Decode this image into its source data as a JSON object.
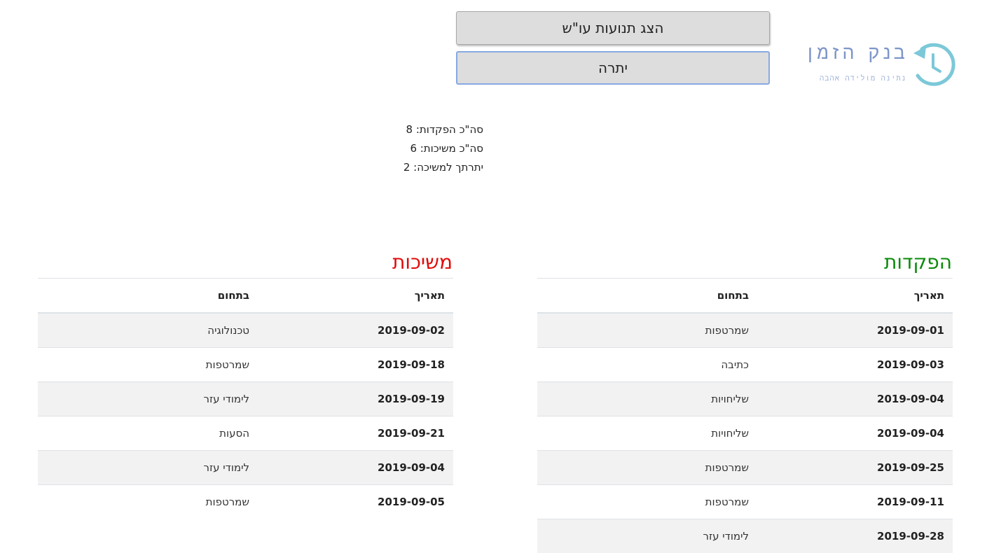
{
  "logo": {
    "title": "בנק הזמן",
    "subtitle": "נתינה מולידה אהבה",
    "colors": {
      "text": "#7d95c7",
      "clock": "#7cc8d8"
    }
  },
  "buttons": {
    "show_transactions": "הצג תנועות עו\"ש",
    "balance": "יתרה"
  },
  "totals": {
    "deposits_line": "סה\"כ הפקדות: 8",
    "withdrawals_line": "סה\"כ משיכות: 6",
    "balance_line": "יתרתך למשיכה: 2"
  },
  "deposits": {
    "title": "הפקדות",
    "columns": {
      "date": "תאריך",
      "field": "בתחום"
    },
    "rows": [
      {
        "date": "2019-09-01",
        "field": "שמרטפות"
      },
      {
        "date": "2019-09-03",
        "field": "כתיבה"
      },
      {
        "date": "2019-09-04",
        "field": "שליחויות"
      },
      {
        "date": "2019-09-04",
        "field": "שליחויות"
      },
      {
        "date": "2019-09-25",
        "field": "שמרטפות"
      },
      {
        "date": "2019-09-11",
        "field": "שמרטפות"
      },
      {
        "date": "2019-09-28",
        "field": "לימודי עזר"
      }
    ]
  },
  "withdrawals": {
    "title": "משיכות",
    "columns": {
      "date": "תאריך",
      "field": "בתחום"
    },
    "rows": [
      {
        "date": "2019-09-02",
        "field": "טכנולוגיה"
      },
      {
        "date": "2019-09-18",
        "field": "שמרטפות"
      },
      {
        "date": "2019-09-19",
        "field": "לימודי עזר"
      },
      {
        "date": "2019-09-21",
        "field": "הסעות"
      },
      {
        "date": "2019-09-04",
        "field": "לימודי עזר"
      },
      {
        "date": "2019-09-05",
        "field": "שמרטפות"
      }
    ]
  }
}
